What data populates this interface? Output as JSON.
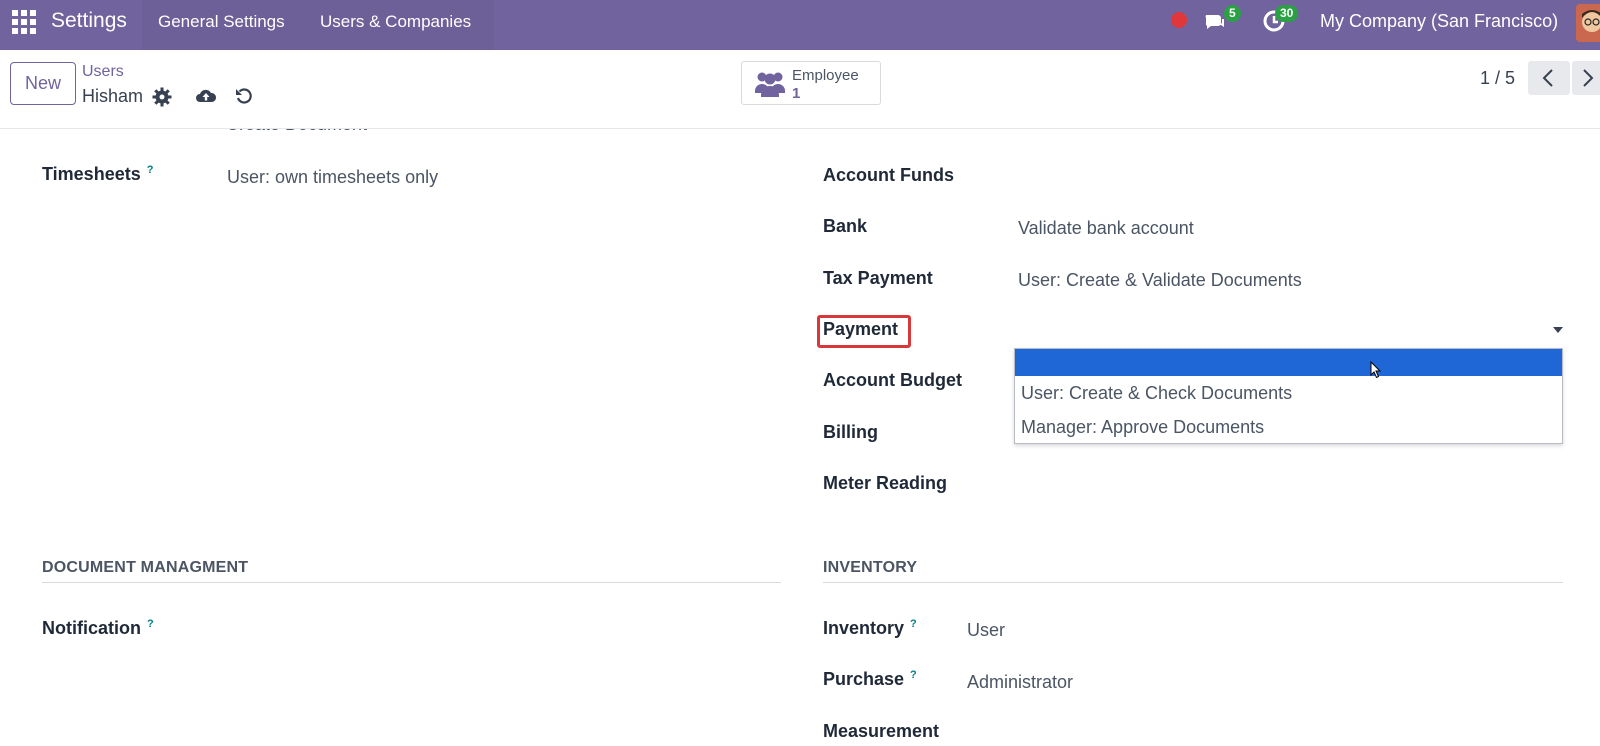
{
  "navbar": {
    "app_title": "Settings",
    "menu": [
      "General Settings",
      "Users & Companies"
    ],
    "messages_count": "5",
    "activities_count": "30",
    "company": "My Company (San Francisco)",
    "bg_color": "#71639e"
  },
  "control_panel": {
    "new_label": "New",
    "breadcrumb_parent": "Users",
    "breadcrumb_current": "Hisham",
    "employee_label": "Employee",
    "employee_count": "1",
    "pager": "1 / 5"
  },
  "form": {
    "cut_value": "Create Document",
    "timesheets_label": "Timesheets",
    "timesheets_help": "?",
    "timesheets_value": "User: own timesheets only",
    "account_funds_label": "Account Funds",
    "bank_label": "Bank",
    "bank_value": "Validate bank account",
    "tax_payment_label": "Tax Payment",
    "tax_payment_value": "User: Create & Validate Documents",
    "payment_label": "Payment",
    "account_budget_label": "Account Budget",
    "billing_label": "Billing",
    "meter_reading_label": "Meter Reading",
    "doc_section": "DOCUMENT MANAGMENT",
    "notification_label": "Notification",
    "notification_help": "?",
    "inventory_section": "INVENTORY",
    "inventory_label": "Inventory",
    "inventory_help": "?",
    "inventory_value": "User",
    "purchase_label": "Purchase",
    "purchase_help": "?",
    "purchase_value": "Administrator",
    "measurement_label": "Measurement"
  },
  "payment_dropdown": {
    "options": [
      "",
      "User: Create & Check Documents",
      "Manager: Approve Documents"
    ],
    "selected_color": "#1f66d6"
  }
}
